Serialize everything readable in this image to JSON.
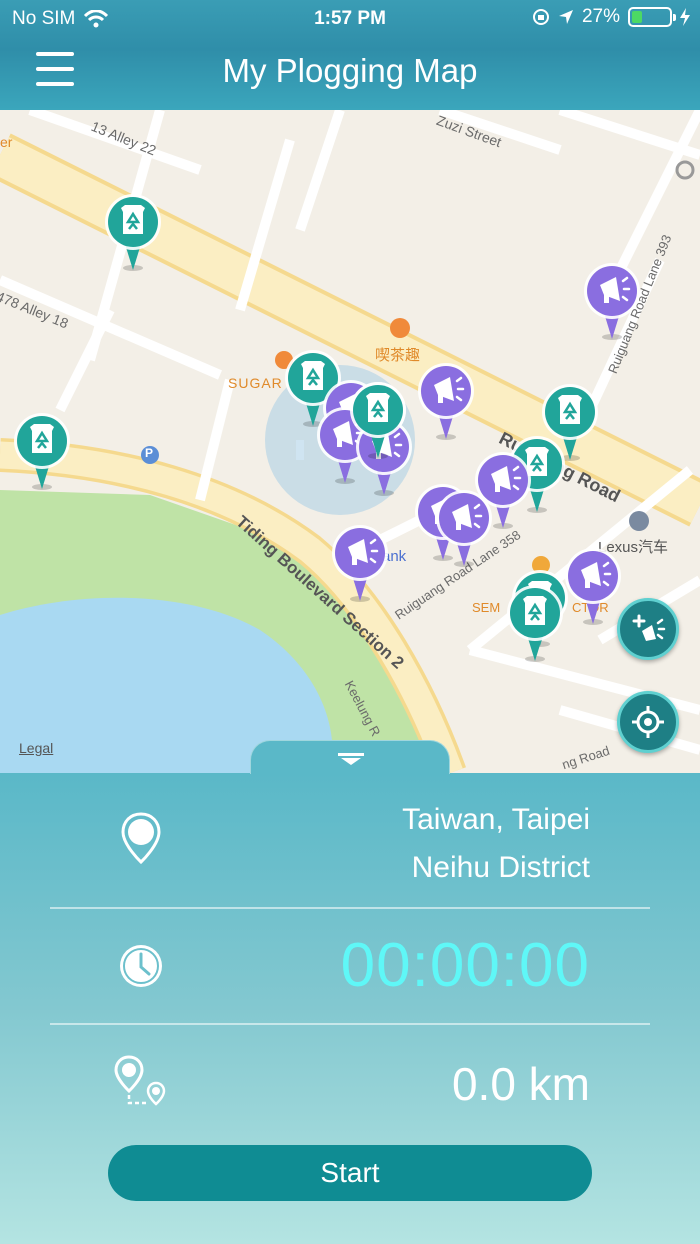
{
  "status_bar": {
    "carrier": "No SIM",
    "time": "1:57 PM",
    "battery": "27%",
    "battery_level": 0.27
  },
  "header": {
    "title": "My Plogging Map"
  },
  "map": {
    "street_labels": {
      "alley22": "13 Alley 22",
      "zuzi": "Zuzi Street",
      "alley18": "478 Alley 18",
      "ruiguang_lane393": "Ruiguang Road Lane 393",
      "ruiguang_road": "Ruiguang Road",
      "tiding": "Tiding Boulevard Section 2",
      "lane358": "Ruiguang Road Lane 358",
      "keelung": "Keelung R",
      "road_bottom": "ng Road"
    },
    "poi_labels": {
      "sugar": "SUGAR",
      "tea": "喫茶趣",
      "lexus": "Lexus汽车",
      "bank": "ank",
      "sem": "SEM",
      "ctor": "CTOR",
      "er": "er",
      "parking": "P"
    },
    "legal": "Legal"
  },
  "info": {
    "location_line1": "Taiwan, Taipei",
    "location_line2": "Neihu District",
    "timer": "00:00:00",
    "distance": "0.0 km"
  },
  "start_button": "Start",
  "colors": {
    "recycle_pin": "#21a59a",
    "report_pin": "#8a6ee0",
    "timer": "#5ff7f7",
    "button": "#0f8c93"
  }
}
